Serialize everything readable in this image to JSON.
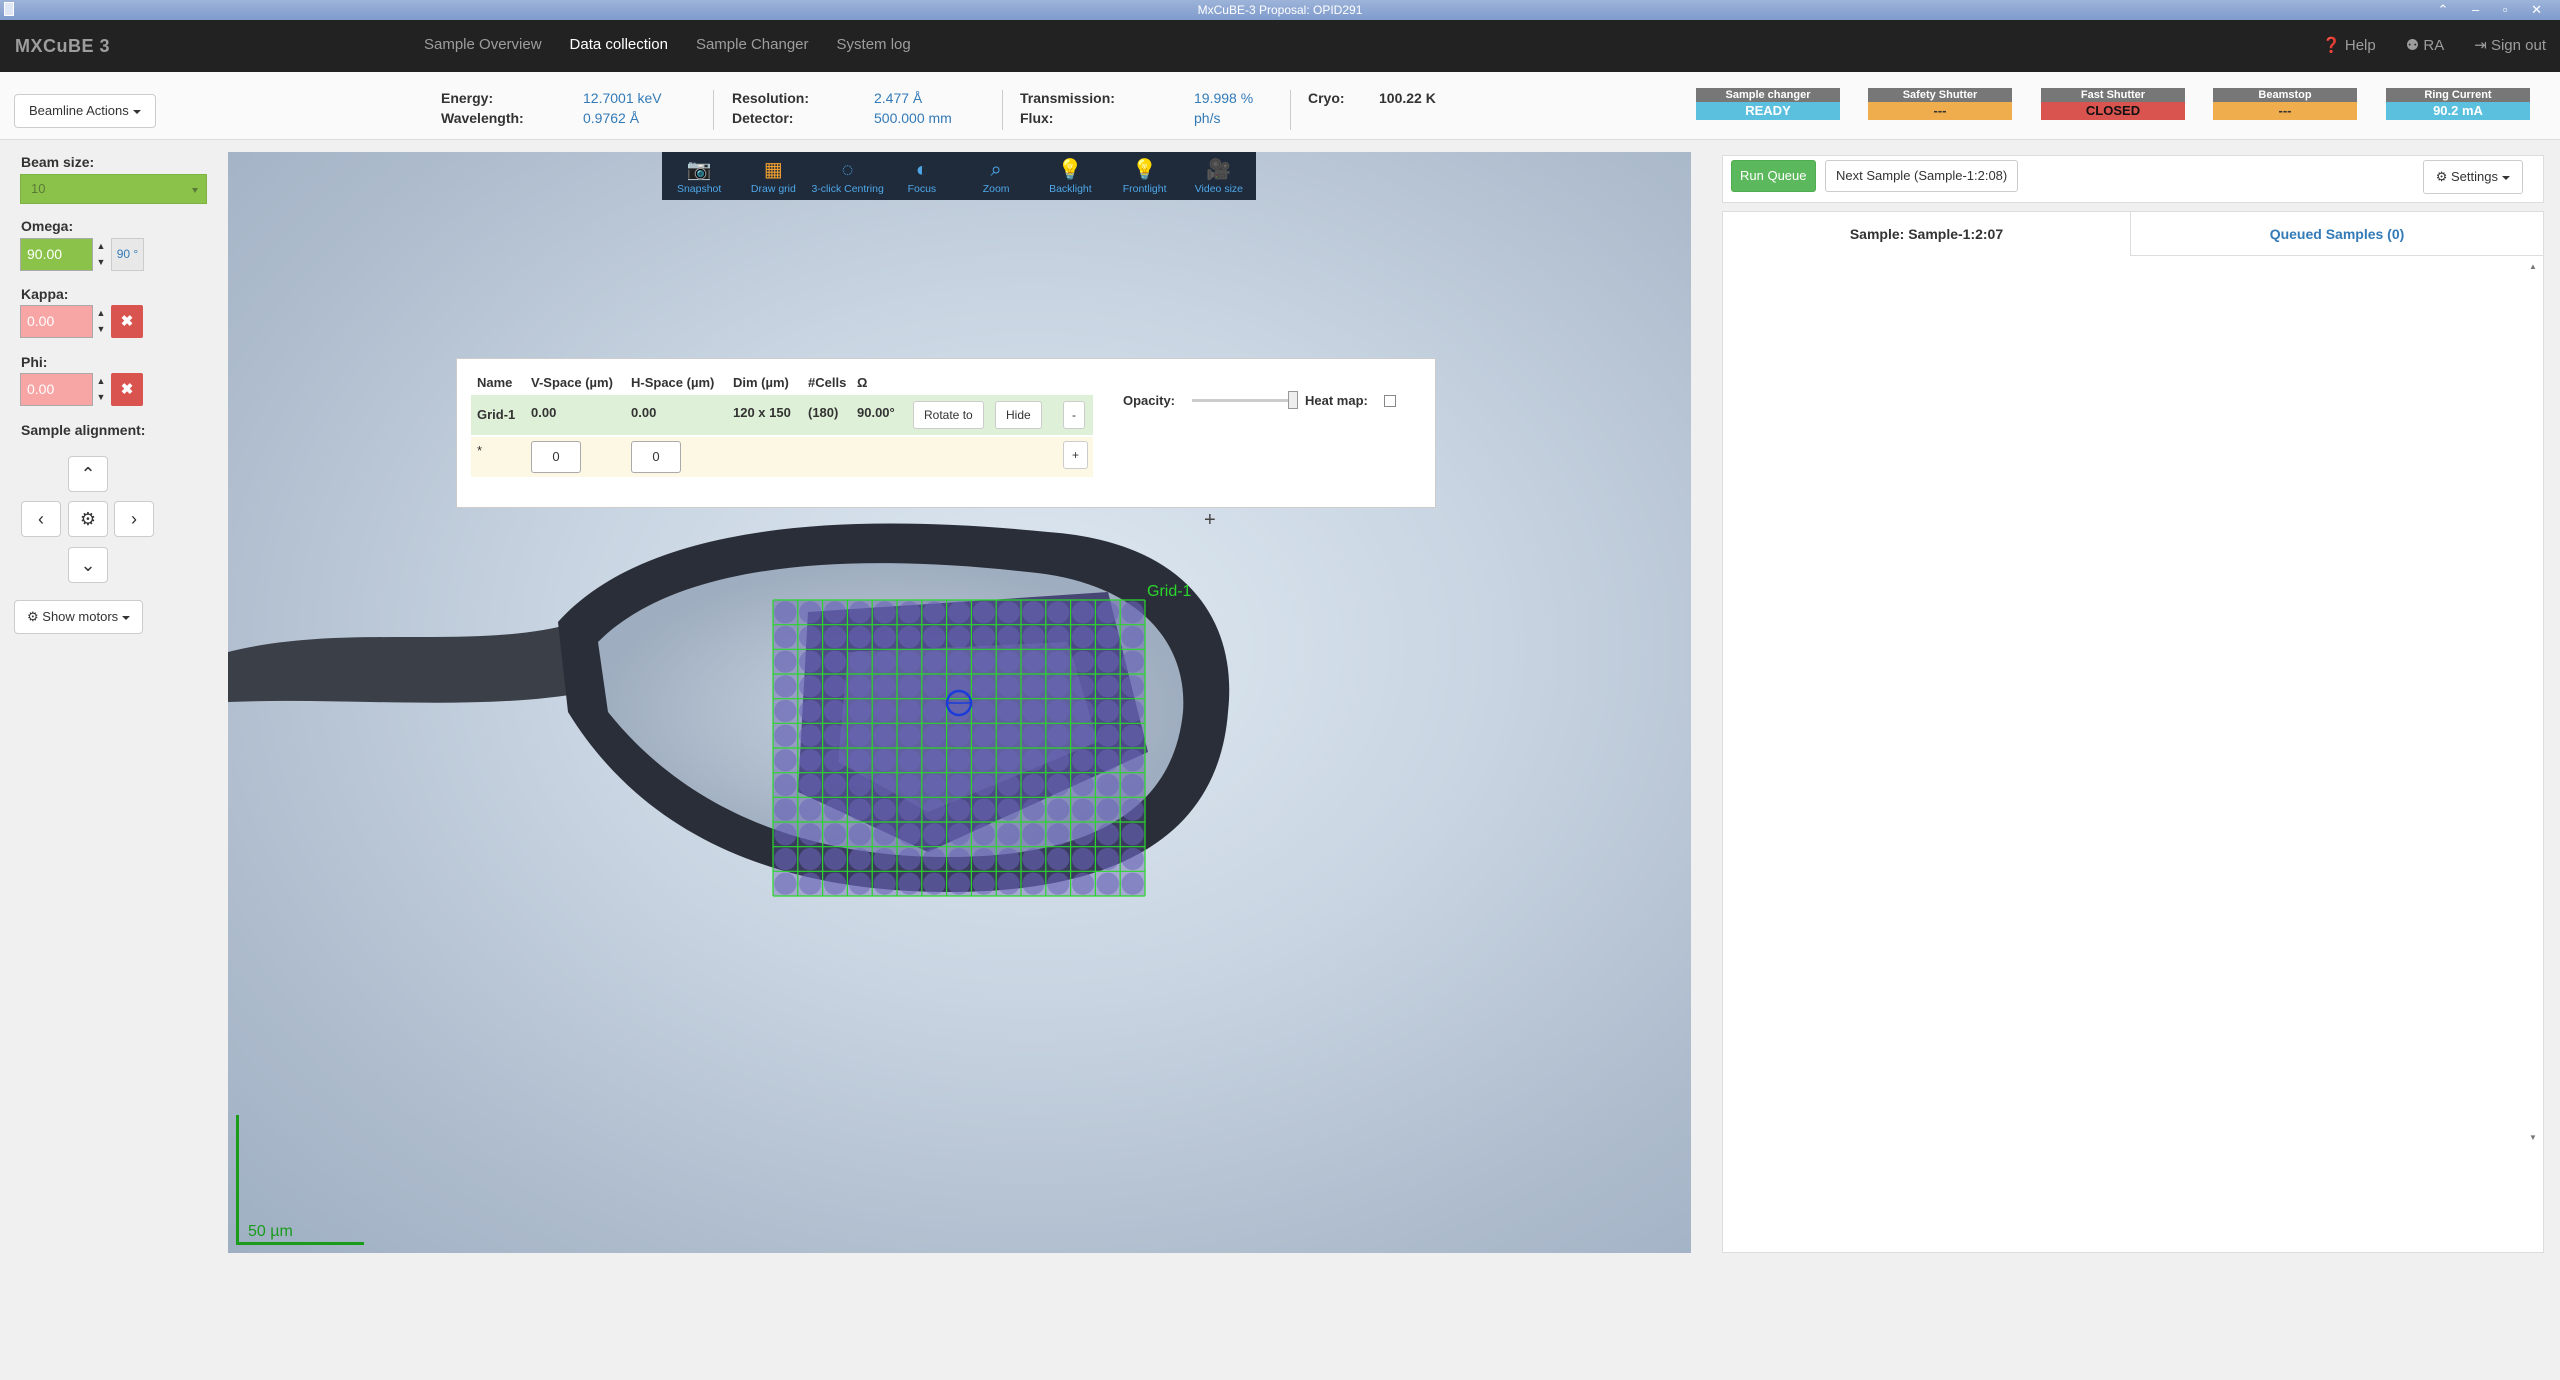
{
  "window": {
    "title": "MxCuBE-3 Proposal: OPID291"
  },
  "navbar": {
    "brand": "MXCuBE 3",
    "links": [
      "Sample Overview",
      "Data collection",
      "Sample Changer",
      "System log"
    ],
    "active_link": "Data collection",
    "help": "Help",
    "ra": "RA",
    "sign_out": "Sign out"
  },
  "beamline": {
    "actions_label": "Beamline Actions",
    "energy_label": "Energy:",
    "energy_value": "12.7001 keV",
    "wavelength_label": "Wavelength:",
    "wavelength_value": "0.9762 Å",
    "resolution_label": "Resolution:",
    "resolution_value": "2.477 Å",
    "detector_label": "Detector:",
    "detector_value": "500.000 mm",
    "transmission_label": "Transmission:",
    "transmission_value": "19.998 %",
    "flux_label": "Flux:",
    "flux_value": "ph/s",
    "cryo_label": "Cryo:",
    "cryo_value": "100.22 K",
    "status": [
      {
        "label": "Sample changer",
        "value": "READY",
        "color": "#5bc0de"
      },
      {
        "label": "Safety Shutter",
        "value": "---",
        "color": "#f0ad4e"
      },
      {
        "label": "Fast Shutter",
        "value": "CLOSED",
        "color": "#d9534f"
      },
      {
        "label": "Beamstop",
        "value": "---",
        "color": "#f0ad4e"
      },
      {
        "label": "Ring Current",
        "value": "90.2 mA",
        "color": "#5bc0de"
      }
    ]
  },
  "left": {
    "beam_size_label": "Beam size:",
    "beam_size_value": "10",
    "omega_label": "Omega:",
    "omega_value": "90.00",
    "omega_badge": "90 °",
    "kappa_label": "Kappa:",
    "kappa_value": "0.00",
    "phi_label": "Phi:",
    "phi_value": "0.00",
    "alignment_label": "Sample alignment:",
    "show_motors": "Show motors"
  },
  "toolbar": {
    "snapshot": "Snapshot",
    "draw_grid": "Draw grid",
    "centring": "3-click Centring",
    "focus": "Focus",
    "zoom": "Zoom",
    "backlight": "Backlight",
    "frontlight": "Frontlight",
    "video_size": "Video size"
  },
  "grid_table": {
    "headers": [
      "Name",
      "V-Space (µm)",
      "H-Space (µm)",
      "Dim (µm)",
      "#Cells",
      "Ω"
    ],
    "row": {
      "name": "Grid-1",
      "v_space": "0.00",
      "h_space": "0.00",
      "dim": "120 x 150",
      "cells": "(180)",
      "omega": "90.00°"
    },
    "rotate_to": "Rotate to",
    "hide": "Hide",
    "remove": "-",
    "new_marker": "*",
    "new_v": "0",
    "new_h": "0",
    "add": "+",
    "opacity_label": "Opacity:",
    "opacity": 0.95,
    "heatmap_label": "Heat map:"
  },
  "video": {
    "grid_label": "Grid-1",
    "grid_rows": 12,
    "grid_cols": 15,
    "scale_label": "50 µm"
  },
  "queue": {
    "run_queue": "Run Queue",
    "next_sample": "Next Sample (Sample-1:2:08)",
    "settings": "Settings",
    "tab_sample": "Sample: Sample-1:2:07",
    "tab_queued": "Queued Samples (0)"
  },
  "colors": {
    "grid_line": "#2bd62b",
    "grid_fill": "#5a4fa8",
    "scale": "#1a9c1a",
    "accent": "#337ab7"
  }
}
